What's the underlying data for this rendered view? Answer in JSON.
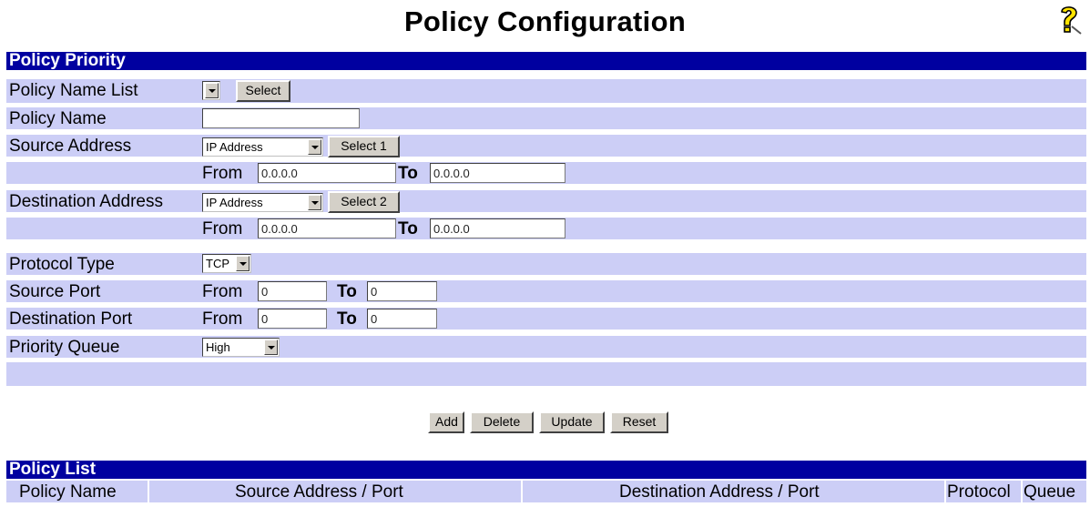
{
  "page": {
    "title": "Policy Configuration"
  },
  "icons": {
    "help": "help-question-icon"
  },
  "colors": {
    "section_bar": "#0000a0",
    "row_bg": "#cccef6",
    "button_face": "#d4d0c8"
  },
  "policy_priority": {
    "header": "Policy Priority",
    "policy_name_list": {
      "label": "Policy Name List",
      "select_value": "",
      "button": "Select"
    },
    "policy_name": {
      "label": "Policy Name",
      "value": ""
    },
    "source_address": {
      "label": "Source Address",
      "type_value": "IP Address",
      "button": "Select 1",
      "from_label": "From",
      "from_value": "0.0.0.0",
      "to_label": "To",
      "to_value": "0.0.0.0"
    },
    "destination_address": {
      "label": "Destination Address",
      "type_value": "IP Address",
      "button": "Select 2",
      "from_label": "From",
      "from_value": "0.0.0.0",
      "to_label": "To",
      "to_value": "0.0.0.0"
    },
    "protocol_type": {
      "label": "Protocol Type",
      "value": "TCP"
    },
    "source_port": {
      "label": "Source Port",
      "from_label": "From",
      "from_value": "0",
      "to_label": "To",
      "to_value": "0"
    },
    "destination_port": {
      "label": "Destination Port",
      "from_label": "From",
      "from_value": "0",
      "to_label": "To",
      "to_value": "0"
    },
    "priority_queue": {
      "label": "Priority Queue",
      "value": "High"
    }
  },
  "actions": {
    "add": "Add",
    "delete": "Delete",
    "update": "Update",
    "reset": "Reset"
  },
  "policy_list": {
    "header": "Policy List",
    "columns": [
      "Policy Name",
      "Source Address / Port",
      "Destination Address / Port",
      "Protocol",
      "Queue"
    ]
  }
}
